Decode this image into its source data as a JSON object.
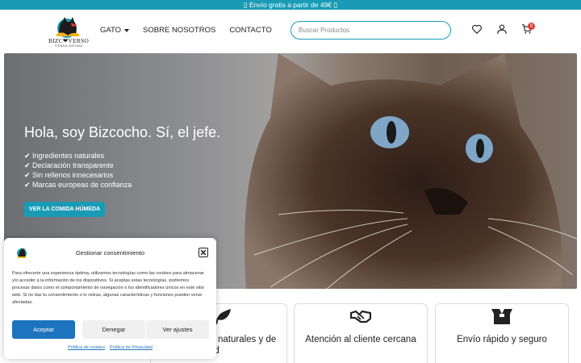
{
  "topbar": {
    "text": "▯ Envío gratis a partir de 49€ ▯"
  },
  "header": {
    "logo_text": "BIZC❤VERSO",
    "logo_sub": "TIENDA GATUNA",
    "nav": [
      {
        "label": "GATO"
      },
      {
        "label": "SOBRE NOSOTROS"
      },
      {
        "label": "CONTACTO"
      }
    ],
    "search_placeholder": "Buscar Productos",
    "cart_count": "0",
    "icons": [
      "heart-icon",
      "user-icon",
      "cart-icon"
    ]
  },
  "hero": {
    "title": "Hola, soy Bizcocho. Sí, el jefe.",
    "bullets": [
      "✔ Ingredientes naturales",
      "✔ Declaración transparente",
      "✔ Sin rellenos innecesarios",
      "✔ Marcas europeas de confianza"
    ],
    "button": "VER LA COMIDA HÚMEDA"
  },
  "features": [
    {
      "title": "naturales y de",
      "title2": "idad",
      "icon": "leaf-icon"
    },
    {
      "title": "Atención al cliente cercana",
      "icon": "handshake-icon"
    },
    {
      "title": "Envío rápido y seguro",
      "icon": "box-icon"
    }
  ],
  "cookie": {
    "title": "Gestionar consentimiento",
    "text": "Para ofrecerte una experiencia óptima, utilizamos tecnologías como las cookies para almacenar y/o acceder a la información de los dispositivos. Si aceptas estas tecnologías, podremos procesar datos como el comportamiento de navegación o los identificadores únicos en este sitio web. Si no das tu consentimiento o lo retiras, algunas características y funciones pueden verse afectadas.",
    "accept": "Aceptar",
    "deny": "Denegar",
    "adjust": "Ver ajustes",
    "link_cookies": "Política de cookies",
    "link_privacy": "Política de Privacidad"
  },
  "colors": {
    "accent": "#1a9bb5",
    "primary_button": "#1e73be",
    "badge": "#e53935"
  }
}
